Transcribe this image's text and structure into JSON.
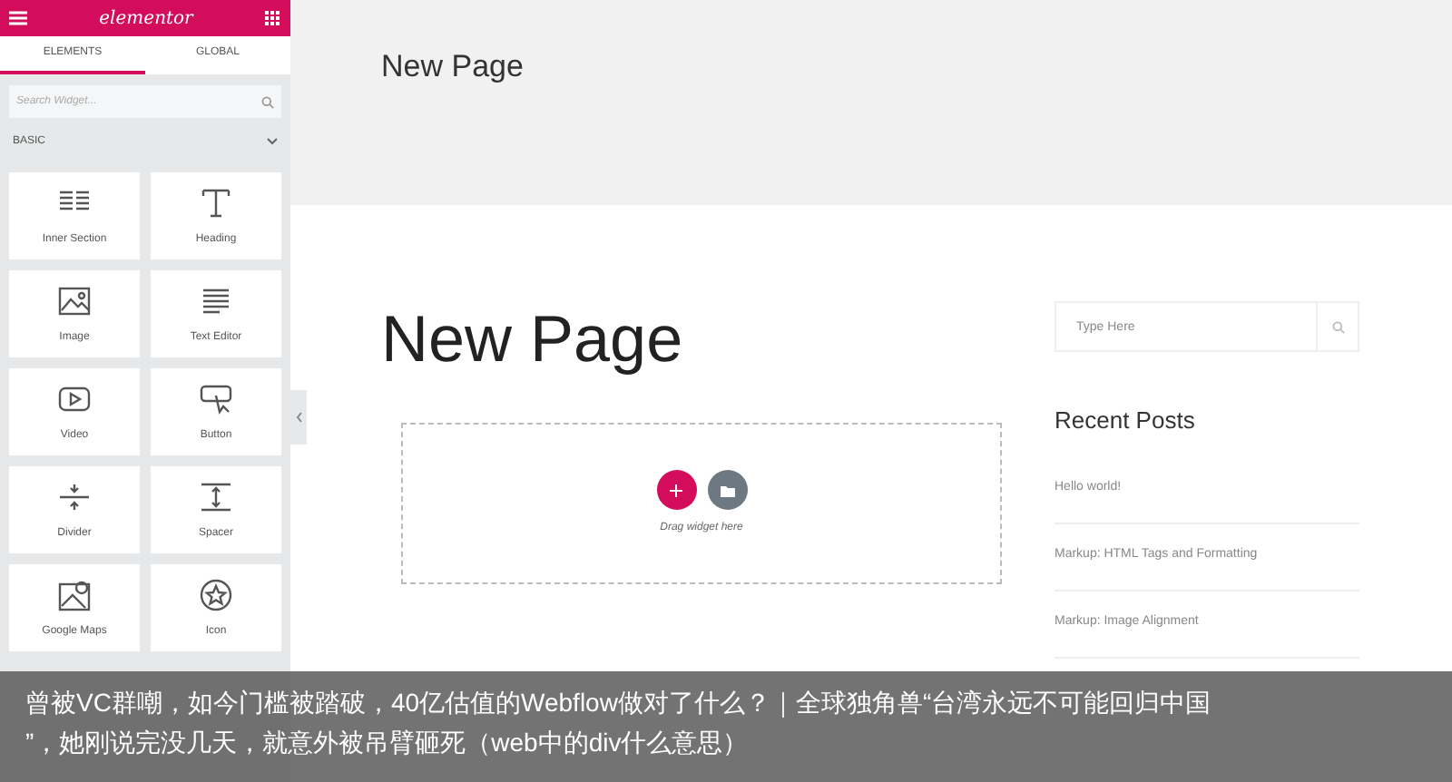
{
  "sidebar": {
    "logo": "elementor",
    "tabs": [
      {
        "label": "ELEMENTS",
        "selected": true
      },
      {
        "label": "GLOBAL",
        "selected": false
      }
    ],
    "search": {
      "placeholder": "Search Widget..."
    },
    "category": {
      "label": "BASIC",
      "expanded": true
    },
    "widgets": [
      {
        "label": "Inner Section",
        "kind": "section"
      },
      {
        "label": "Heading",
        "kind": "heading"
      },
      {
        "label": "Image",
        "kind": "image"
      },
      {
        "label": "Text Editor",
        "kind": "text"
      },
      {
        "label": "Video",
        "kind": "video"
      },
      {
        "label": "Button",
        "kind": "button"
      },
      {
        "label": "Divider",
        "kind": "divider"
      },
      {
        "label": "Spacer",
        "kind": "spacer"
      },
      {
        "label": "Google Maps",
        "kind": "map"
      },
      {
        "label": "Icon",
        "kind": "icon"
      }
    ]
  },
  "page": {
    "header_title": "New Page",
    "title": "New Page",
    "dropzone": {
      "hint": "Drag widget here"
    }
  },
  "widgets_area": {
    "search": {
      "placeholder": "Type Here"
    },
    "recent_title": "Recent Posts",
    "posts": [
      "Hello world!",
      "Markup: HTML Tags and Formatting",
      "Markup: Image Alignment"
    ]
  },
  "caption_lines": [
    "曾被VC群嘲，如今门槛被踏破，40亿估值的Webflow做对了什么？｜全球独角兽“台湾永远不可能回归中国",
    "”，她刚说完没几天，就意外被吊臂砸死（web中的div什么意思）"
  ]
}
